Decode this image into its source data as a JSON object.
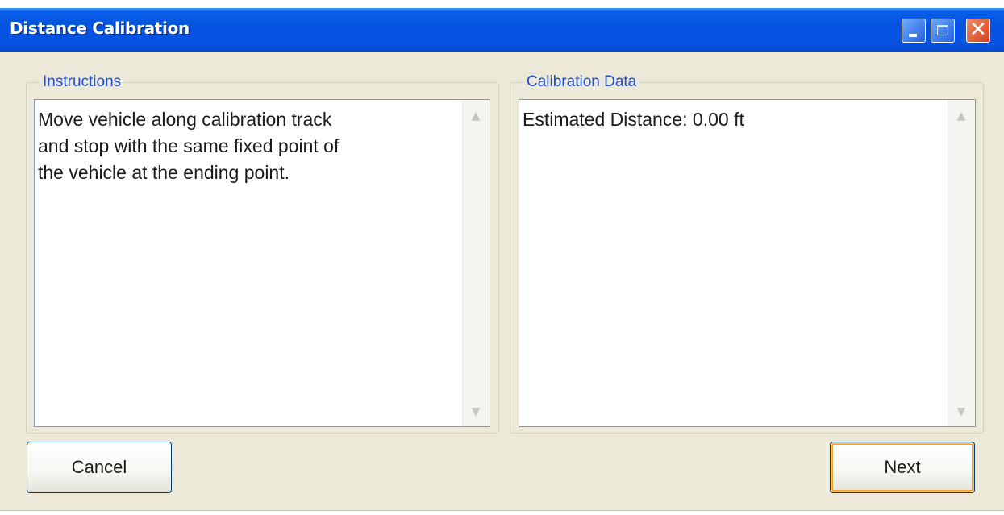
{
  "window": {
    "title": "Distance Calibration"
  },
  "title_controls": {
    "minimize_icon": "minimize-icon",
    "maximize_icon": "maximize-icon",
    "close_icon": "close-icon",
    "close_glyph": "✕"
  },
  "instructions": {
    "legend": "Instructions",
    "text": "Move vehicle along calibration track\nand stop with the same fixed point of\nthe vehicle at the ending point."
  },
  "calibration_data": {
    "legend": "Calibration Data",
    "text": "Estimated Distance: 0.00 ft"
  },
  "scrollbar": {
    "up_glyph": "▲",
    "down_glyph": "▼"
  },
  "buttons": {
    "cancel_label": "Cancel",
    "next_label": "Next"
  },
  "colors": {
    "titlebar": "#0553e0",
    "legend_text": "#1f4fd0",
    "window_bg": "#ece9d8",
    "default_button_highlight": "#f6c25f"
  }
}
